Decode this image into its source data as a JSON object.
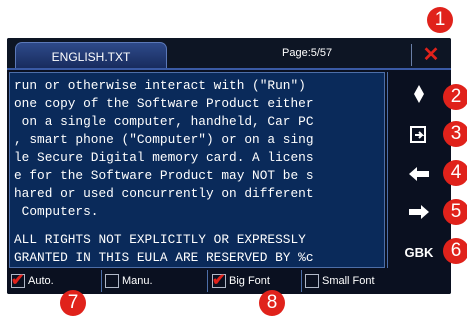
{
  "header": {
    "tab_label": "ENGLISH.TXT",
    "page_info": "Page:5/57",
    "close_icon": "close-icon"
  },
  "document": {
    "lines": [
      "run or otherwise interact with (\"Run\")",
      "one copy of the Software Product either",
      " on a single computer, handheld, Car PC",
      ", smart phone (\"Computer\") or on a sing",
      "le Secure Digital memory card. A licens",
      "e for the Software Product may NOT be s",
      "hared or used concurrently on different",
      " Computers.",
      "",
      "ALL RIGHTS NOT EXPLICITLY OR EXPRESSLY",
      "GRANTED IN THIS EULA ARE RESERVED BY %c"
    ]
  },
  "side_buttons": [
    {
      "icon": "bookmark-icon",
      "label": ""
    },
    {
      "icon": "jump-page-icon",
      "label": ""
    },
    {
      "icon": "arrow-left-icon",
      "label": ""
    },
    {
      "icon": "arrow-right-icon",
      "label": ""
    },
    {
      "icon": "encoding-icon",
      "label": "GBK"
    }
  ],
  "options": [
    {
      "label": "Auto.",
      "checked": true
    },
    {
      "label": "Manu.",
      "checked": false
    },
    {
      "label": "Big Font",
      "checked": true
    },
    {
      "label": "Small Font",
      "checked": false
    }
  ],
  "callouts": [
    "1",
    "2",
    "3",
    "4",
    "5",
    "6",
    "7",
    "8"
  ],
  "colors": {
    "accent_red": "#e0221b",
    "panel_bg": "#0a1020",
    "text_bg": "#0a2a5a",
    "tab_blue": "#2e4a8a"
  }
}
